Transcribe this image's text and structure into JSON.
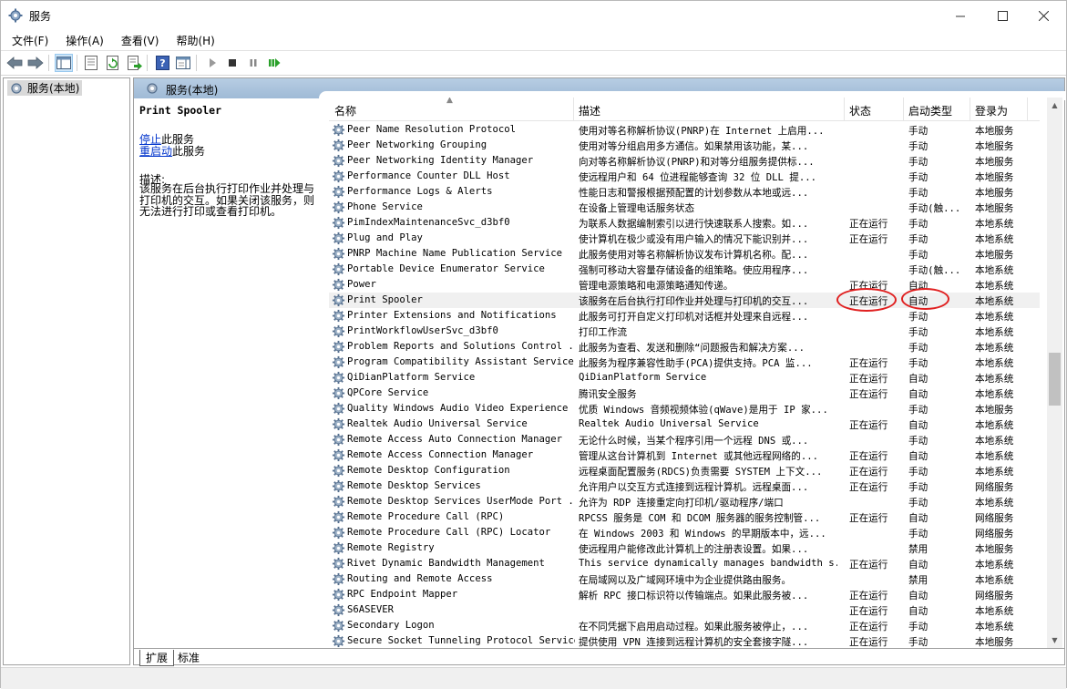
{
  "window": {
    "title": "服务"
  },
  "menu": [
    "文件(F)",
    "操作(A)",
    "查看(V)",
    "帮助(H)"
  ],
  "tree": {
    "root": "服务(本地)"
  },
  "pane": {
    "header": "服务(本地)"
  },
  "details": {
    "service_title": "Print Spooler",
    "stop_link": "停止",
    "stop_suffix": "此服务",
    "restart_link": "重启动",
    "restart_suffix": "此服务",
    "desc_label": "描述:",
    "desc_text": "该服务在后台执行打印作业并处理与打印机的交互。如果关闭该服务，则无法进行打印或查看打印机。"
  },
  "columns": {
    "name": "名称",
    "desc": "描述",
    "status": "状态",
    "startup": "启动类型",
    "logon": "登录为"
  },
  "rows": [
    {
      "name": "Peer Name Resolution Protocol",
      "desc": "使用对等名称解析协议(PNRP)在 Internet 上启用...",
      "status": "",
      "startup": "手动",
      "logon": "本地服务"
    },
    {
      "name": "Peer Networking Grouping",
      "desc": "使用对等分组启用多方通信。如果禁用该功能，某...",
      "status": "",
      "startup": "手动",
      "logon": "本地服务"
    },
    {
      "name": "Peer Networking Identity Manager",
      "desc": "向对等名称解析协议(PNRP)和对等分组服务提供标...",
      "status": "",
      "startup": "手动",
      "logon": "本地服务"
    },
    {
      "name": "Performance Counter DLL Host",
      "desc": "使远程用户和 64 位进程能够查询 32 位 DLL 提...",
      "status": "",
      "startup": "手动",
      "logon": "本地服务"
    },
    {
      "name": "Performance Logs & Alerts",
      "desc": "性能日志和警报根据预配置的计划参数从本地或远...",
      "status": "",
      "startup": "手动",
      "logon": "本地服务"
    },
    {
      "name": "Phone Service",
      "desc": "在设备上管理电话服务状态",
      "status": "",
      "startup": "手动(触...",
      "logon": "本地服务"
    },
    {
      "name": "PimIndexMaintenanceSvc_d3bf0",
      "desc": "为联系人数据编制索引以进行快速联系人搜索。如...",
      "status": "正在运行",
      "startup": "手动",
      "logon": "本地系统"
    },
    {
      "name": "Plug and Play",
      "desc": "使计算机在极少或没有用户输入的情况下能识别并...",
      "status": "正在运行",
      "startup": "手动",
      "logon": "本地系统"
    },
    {
      "name": "PNRP Machine Name Publication Service",
      "desc": "此服务使用对等名称解析协议发布计算机名称。配...",
      "status": "",
      "startup": "手动",
      "logon": "本地服务"
    },
    {
      "name": "Portable Device Enumerator Service",
      "desc": "强制可移动大容量存储设备的组策略。使应用程序...",
      "status": "",
      "startup": "手动(触...",
      "logon": "本地系统"
    },
    {
      "name": "Power",
      "desc": "管理电源策略和电源策略通知传递。",
      "status": "正在运行",
      "startup": "自动",
      "logon": "本地系统"
    },
    {
      "name": "Print Spooler",
      "desc": "该服务在后台执行打印作业并处理与打印机的交互...",
      "status": "正在运行",
      "startup": "自动",
      "logon": "本地系统"
    },
    {
      "name": "Printer Extensions and Notifications",
      "desc": "此服务可打开自定义打印机对话框并处理来自远程...",
      "status": "",
      "startup": "手动",
      "logon": "本地系统"
    },
    {
      "name": "PrintWorkflowUserSvc_d3bf0",
      "desc": "打印工作流",
      "status": "",
      "startup": "手动",
      "logon": "本地系统"
    },
    {
      "name": "Problem Reports and Solutions Control ...",
      "desc": "此服务为查看、发送和删除“问题报告和解决方案...",
      "status": "",
      "startup": "手动",
      "logon": "本地系统"
    },
    {
      "name": "Program Compatibility Assistant Service",
      "desc": "此服务为程序兼容性助手(PCA)提供支持。PCA 监...",
      "status": "正在运行",
      "startup": "手动",
      "logon": "本地系统"
    },
    {
      "name": "QiDianPlatform Service",
      "desc": "QiDianPlatform Service",
      "status": "正在运行",
      "startup": "自动",
      "logon": "本地系统"
    },
    {
      "name": "QPCore Service",
      "desc": "腾讯安全服务",
      "status": "正在运行",
      "startup": "自动",
      "logon": "本地系统"
    },
    {
      "name": "Quality Windows Audio Video Experience",
      "desc": "优质 Windows 音频视频体验(qWave)是用于 IP 家...",
      "status": "",
      "startup": "手动",
      "logon": "本地服务"
    },
    {
      "name": "Realtek Audio Universal Service",
      "desc": "Realtek Audio Universal Service",
      "status": "正在运行",
      "startup": "自动",
      "logon": "本地系统"
    },
    {
      "name": "Remote Access Auto Connection Manager",
      "desc": "无论什么时候，当某个程序引用一个远程 DNS 或...",
      "status": "",
      "startup": "手动",
      "logon": "本地系统"
    },
    {
      "name": "Remote Access Connection Manager",
      "desc": "管理从这台计算机到 Internet 或其他远程网络的...",
      "status": "正在运行",
      "startup": "自动",
      "logon": "本地系统"
    },
    {
      "name": "Remote Desktop Configuration",
      "desc": "远程桌面配置服务(RDCS)负责需要 SYSTEM 上下文...",
      "status": "正在运行",
      "startup": "手动",
      "logon": "本地系统"
    },
    {
      "name": "Remote Desktop Services",
      "desc": "允许用户以交互方式连接到远程计算机。远程桌面...",
      "status": "正在运行",
      "startup": "手动",
      "logon": "网络服务"
    },
    {
      "name": "Remote Desktop Services UserMode Port ...",
      "desc": "允许为 RDP 连接重定向打印机/驱动程序/端口",
      "status": "",
      "startup": "手动",
      "logon": "本地系统"
    },
    {
      "name": "Remote Procedure Call (RPC)",
      "desc": "RPCSS 服务是 COM 和 DCOM 服务器的服务控制管...",
      "status": "正在运行",
      "startup": "自动",
      "logon": "网络服务"
    },
    {
      "name": "Remote Procedure Call (RPC) Locator",
      "desc": "在 Windows 2003 和 Windows 的早期版本中，远...",
      "status": "",
      "startup": "手动",
      "logon": "网络服务"
    },
    {
      "name": "Remote Registry",
      "desc": "使远程用户能修改此计算机上的注册表设置。如果...",
      "status": "",
      "startup": "禁用",
      "logon": "本地服务"
    },
    {
      "name": "Rivet Dynamic Bandwidth Management",
      "desc": "This service dynamically manages bandwidth s...",
      "status": "正在运行",
      "startup": "自动",
      "logon": "本地系统"
    },
    {
      "name": "Routing and Remote Access",
      "desc": "在局域网以及广域网环境中为企业提供路由服务。",
      "status": "",
      "startup": "禁用",
      "logon": "本地系统"
    },
    {
      "name": "RPC Endpoint Mapper",
      "desc": "解析 RPC 接口标识符以传输端点。如果此服务被...",
      "status": "正在运行",
      "startup": "自动",
      "logon": "网络服务"
    },
    {
      "name": "S6ASEVER",
      "desc": "",
      "status": "正在运行",
      "startup": "自动",
      "logon": "本地系统"
    },
    {
      "name": "Secondary Logon",
      "desc": "在不同凭据下启用启动过程。如果此服务被停止，...",
      "status": "正在运行",
      "startup": "手动",
      "logon": "本地系统"
    },
    {
      "name": "Secure Socket Tunneling Protocol Service",
      "desc": "提供使用 VPN 连接到远程计算机的安全套接字隧...",
      "status": "正在运行",
      "startup": "手动",
      "logon": "本地服务"
    }
  ],
  "bottom_tabs": [
    "扩展",
    "标准"
  ],
  "colors": {
    "header_gradient": "#9fbad6",
    "link": "#0033cc",
    "annotation": "#e02020",
    "selected_row": "#f0f0f0"
  }
}
